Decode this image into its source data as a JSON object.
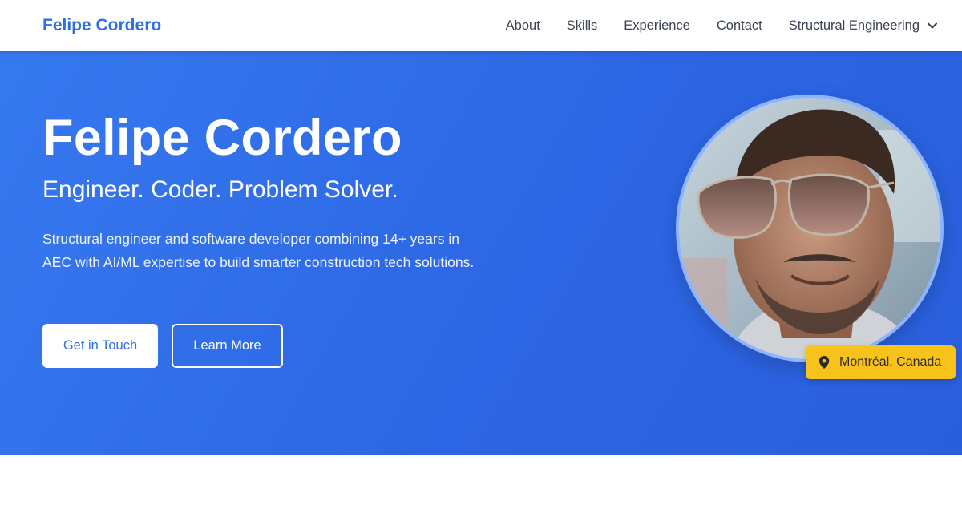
{
  "nav": {
    "brand": "Felipe Cordero",
    "links": [
      "About",
      "Skills",
      "Experience",
      "Contact"
    ],
    "dropdown_label": "Structural Engineering"
  },
  "hero": {
    "title": "Felipe Cordero",
    "subtitle": "Engineer. Coder. Problem Solver.",
    "description": "Structural engineer and software developer combining 14+ years in AEC with AI/ML expertise to build smarter construction tech solutions.",
    "primary_button": "Get in Touch",
    "secondary_button": "Learn More",
    "location": "Montréal, Canada"
  },
  "icons": {
    "dropdown": "chevron-down-icon",
    "location": "map-pin-icon"
  },
  "colors": {
    "brand": "#2f6fe6",
    "hero_bg": "#2d66e4",
    "badge": "#f7c21a"
  }
}
